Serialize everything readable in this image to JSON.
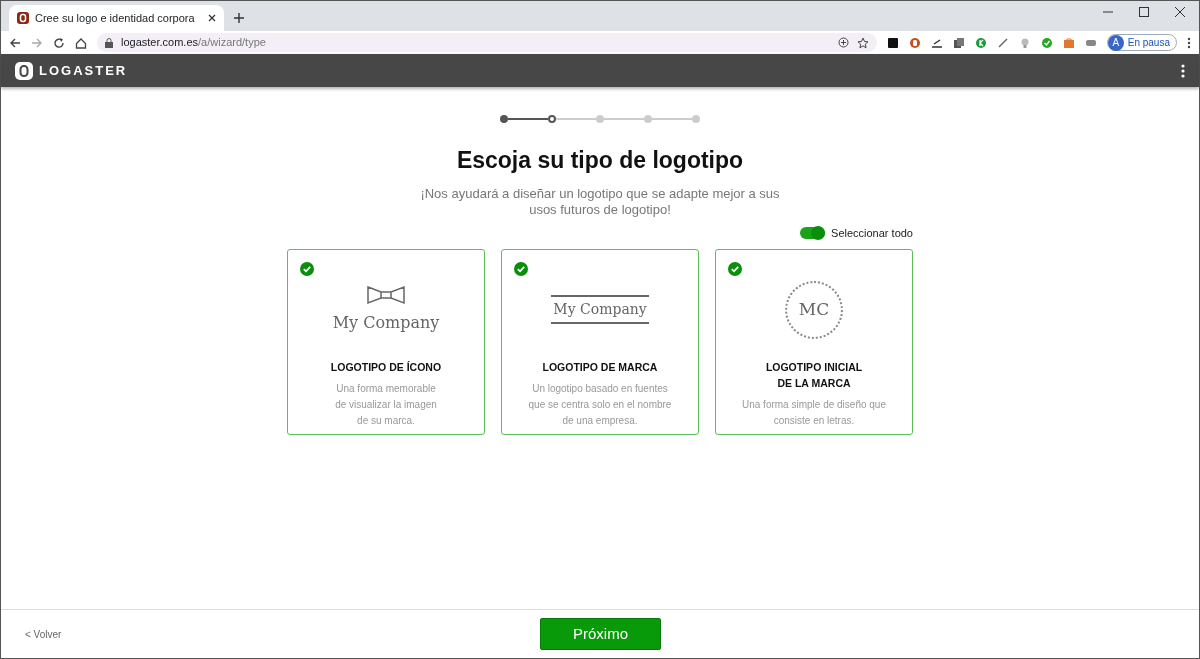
{
  "browser": {
    "tab_title": "Cree su logo e identidad corpora",
    "url_host": "logaster.com.es",
    "url_path": "/a/wizard/type",
    "profile_initial": "A",
    "profile_status": "En pausa"
  },
  "header": {
    "logo_text": "LOGASTER"
  },
  "steps": [
    {
      "completed": true,
      "selected": false
    },
    {
      "completed": false,
      "selected": true
    },
    {
      "completed": false,
      "selected": false
    },
    {
      "completed": false,
      "selected": false
    },
    {
      "completed": false,
      "selected": false
    }
  ],
  "title": "Escoja su tipo de logotipo",
  "subtitle_lines": [
    "¡Nos ayudará a diseñar un logotipo que se adapte mejor a sus",
    "usos futuros de logotipo!"
  ],
  "select_all": {
    "label": "Seleccionar todo",
    "on": true
  },
  "cards": [
    {
      "kind": "icon",
      "art_text": "My Company",
      "title_lines": [
        "LOGOTIPO DE ÍCONO"
      ],
      "desc_lines": [
        "Una forma memorable",
        "de visualizar la imagen",
        "de su marca."
      ],
      "checked": true
    },
    {
      "kind": "brand",
      "art_text": "My Company",
      "title_lines": [
        "LOGOTIPO DE MARCA"
      ],
      "desc_lines": [
        "Un logotipo basado en fuentes",
        "que se centra solo en el nombre",
        "de una empresa."
      ],
      "checked": true
    },
    {
      "kind": "initials",
      "art_text": "MC",
      "title_lines": [
        "LOGOTIPO INICIAL",
        "DE LA MARCA"
      ],
      "desc_lines": [
        "Una forma simple de diseño que",
        "consiste en letras."
      ],
      "checked": true
    }
  ],
  "footer": {
    "back": "< Volver",
    "next": "Próximo"
  }
}
